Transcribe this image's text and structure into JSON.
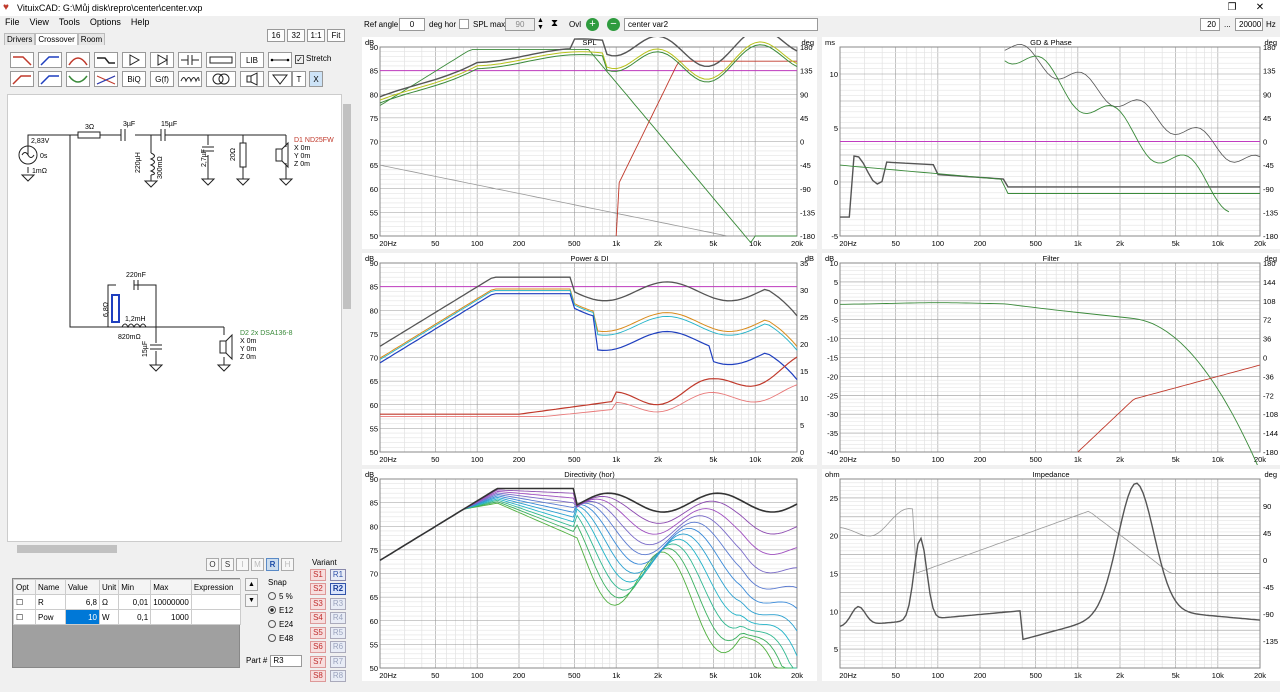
{
  "app": {
    "title": "VituixCAD: G:\\Můj disk\\repro\\center\\center.vxp"
  },
  "menu": [
    "File",
    "View",
    "Tools",
    "Options",
    "Help"
  ],
  "left_tabs": [
    "Drivers",
    "Crossover",
    "Room"
  ],
  "zoom_buttons": [
    "16",
    "32",
    "1:1",
    "Fit"
  ],
  "tools": {
    "row2_labels": [
      "BiQ",
      "G(f)"
    ],
    "lib": "LIB",
    "t": "T",
    "x": "X"
  },
  "stretch": "Stretch",
  "schematic": {
    "src": [
      "2,83V",
      "0s",
      "1mΩ"
    ],
    "r1": "3Ω",
    "c1": "3µF",
    "c2": "15µF",
    "l1a": "220µH",
    "l1b": "300mΩ",
    "c3": "2,7µF",
    "r2": "20Ω",
    "d1": {
      "name": "D1 ND25FW",
      "x": "X 0m",
      "y": "Y 0m",
      "z": "Z 0m"
    },
    "c4": "220nF",
    "r3": "6,8Ω",
    "l2a": "1,2mH",
    "l2b": "820mΩ",
    "c5": "15µF",
    "d2": {
      "name": "D2 2x DSA136-8",
      "x": "X 0m",
      "y": "Y 0m",
      "z": "Z 0m"
    }
  },
  "orm_buttons": [
    "O",
    "S",
    "I",
    "M",
    "R",
    "H"
  ],
  "params": {
    "headers": [
      "Opt",
      "Name",
      "Value",
      "Unit",
      "Min",
      "Max",
      "Expression"
    ],
    "rows": [
      [
        "R",
        "6,8",
        "Ω",
        "0,01",
        "10000000",
        ""
      ],
      [
        "Pow",
        "10",
        "W",
        "0,1",
        "1000",
        ""
      ]
    ]
  },
  "snap": {
    "title": "Snap",
    "opts": [
      "5 %",
      "E12",
      "E24",
      "E48"
    ]
  },
  "part": {
    "label": "Part #",
    "value": "R3"
  },
  "variant": {
    "title": "Variant",
    "s": [
      "S1",
      "S2",
      "S3",
      "S4",
      "S5",
      "S6",
      "S7",
      "S8"
    ],
    "r": [
      "R1",
      "R2",
      "R3",
      "R4",
      "R5",
      "R6",
      "R7",
      "R8"
    ]
  },
  "right_toolbar": {
    "ref_angle_label": "Ref angle",
    "ref_angle": "0",
    "deg_hor": "deg hor",
    "spl_max": "SPL max",
    "spl_val": "90",
    "ovl": "Ovl",
    "name": "center var2",
    "fmin": "20",
    "dots": "...",
    "fmax": "20000",
    "hz": "Hz"
  },
  "colors": {
    "red": "#c0392b",
    "green": "#3a8a3a",
    "blue": "#1f3fbf",
    "orange": "#d88a1a",
    "yellow": "#b7c21a",
    "magenta": "#cc33cc",
    "gray": "#555555",
    "pink": "#e87878",
    "cyan": "#22b3c8"
  },
  "xticks": [
    "20Hz",
    "50",
    "100",
    "200",
    "500",
    "1k",
    "2k",
    "5k",
    "10k",
    "20k"
  ],
  "charts": [
    {
      "title": "SPL",
      "lunit": "dB",
      "runit": "deg",
      "left": [
        "90",
        "85",
        "80",
        "75",
        "70",
        "65",
        "60",
        "55",
        "50"
      ],
      "right": [
        "180",
        "135",
        "90",
        "45",
        "0",
        "-45",
        "-90",
        "-135",
        "-180"
      ],
      "ref": 85
    },
    {
      "title": "GD & Phase",
      "lunit": "ms",
      "runit": "deg",
      "left": [
        "",
        "10",
        "",
        "5",
        "",
        "0",
        "",
        "-5"
      ],
      "right": [
        "180",
        "135",
        "90",
        "45",
        "0",
        "-45",
        "-90",
        "-135",
        "-180"
      ],
      "ref": 5
    },
    {
      "title": "Power & DI",
      "lunit": "dB",
      "runit": "dB",
      "left": [
        "90",
        "85",
        "80",
        "75",
        "70",
        "65",
        "60",
        "55",
        "50"
      ],
      "right": [
        "35",
        "30",
        "25",
        "20",
        "15",
        "10",
        "5",
        "0"
      ],
      "ref": 85
    },
    {
      "title": "Filter",
      "lunit": "dB",
      "runit": "deg",
      "left": [
        "10",
        "5",
        "0",
        "-5",
        "-10",
        "-15",
        "-20",
        "-25",
        "-30",
        "-35",
        "-40"
      ],
      "right": [
        "180",
        "144",
        "108",
        "72",
        "36",
        "0",
        "-36",
        "-72",
        "-108",
        "-144",
        "-180"
      ]
    },
    {
      "title": "Directivity (hor)",
      "lunit": "dB",
      "runit": "",
      "left": [
        "90",
        "85",
        "80",
        "75",
        "70",
        "65",
        "60",
        "55",
        "50"
      ],
      "right": []
    },
    {
      "title": "Impedance",
      "lunit": "ohm",
      "runit": "deg",
      "left": [
        "",
        "25",
        "",
        "20",
        "",
        "15",
        "",
        "10",
        "",
        "5",
        ""
      ],
      "right": [
        "",
        "90",
        "45",
        "0",
        "-45",
        "-90",
        "-135",
        ""
      ]
    }
  ]
}
